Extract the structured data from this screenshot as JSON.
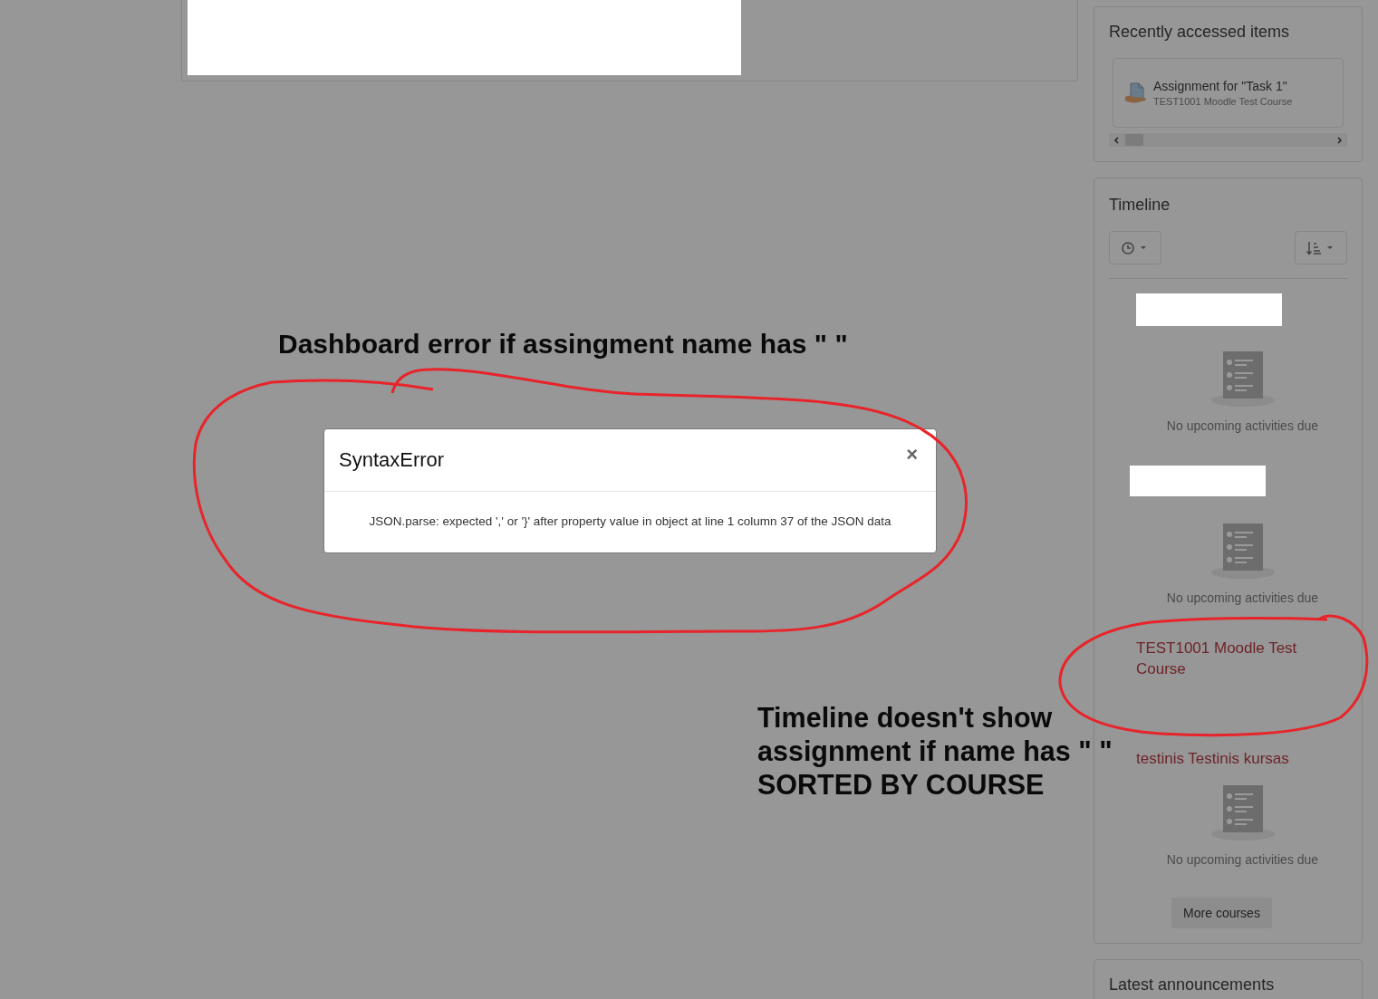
{
  "recent": {
    "title": "Recently accessed items",
    "items": [
      {
        "name": "Assignment for \"Task 1\"",
        "course": "TEST1001 Moodle Test Course"
      }
    ]
  },
  "timeline": {
    "title": "Timeline",
    "courses": [
      {
        "redacted": true,
        "empty_message": "No upcoming activities due"
      },
      {
        "redacted": true,
        "empty_message": "No upcoming activities due"
      },
      {
        "redacted": false,
        "name": "TEST1001 Moodle Test Course"
      },
      {
        "redacted": false,
        "name": "testinis Testinis kursas",
        "empty_message": "No upcoming activities due"
      }
    ],
    "more_button": "More courses"
  },
  "announcements": {
    "title": "Latest announcements"
  },
  "modal": {
    "title": "SyntaxError",
    "close": "×",
    "message": "JSON.parse: expected ',' or '}' after property value in object at line 1 column 37 of the JSON data"
  },
  "annotations": [
    {
      "lines": [
        "Dashboard error if assingment name has \" \""
      ]
    },
    {
      "lines": [
        "Timeline doesn't show",
        "assignment if name has \" \"",
        "SORTED BY COURSE"
      ]
    }
  ]
}
